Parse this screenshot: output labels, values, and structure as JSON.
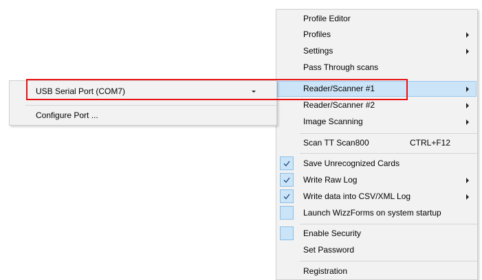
{
  "menu": {
    "items": [
      {
        "label": "Profile Editor"
      },
      {
        "label": "Profiles"
      },
      {
        "label": "Settings"
      },
      {
        "label": "Pass Through scans"
      },
      {
        "label": "Reader/Scanner #1"
      },
      {
        "label": "Reader/Scanner #2"
      },
      {
        "label": "Image Scanning"
      },
      {
        "label": "Scan TT Scan800",
        "shortcut": "CTRL+F12"
      },
      {
        "label": "Save Unrecognized Cards"
      },
      {
        "label": "Write Raw Log"
      },
      {
        "label": "Write data into CSV/XML Log"
      },
      {
        "label": "Launch WizzForms on system startup"
      },
      {
        "label": "Enable Security"
      },
      {
        "label": "Set Password"
      },
      {
        "label": "Registration"
      }
    ]
  },
  "submenu": {
    "port_value": "USB Serial Port (COM7)",
    "configure_label": "Configure Port ..."
  },
  "colors": {
    "menu_bg": "#f2f2f2",
    "highlight": "#cce4f7",
    "annotation": "#e81010"
  }
}
